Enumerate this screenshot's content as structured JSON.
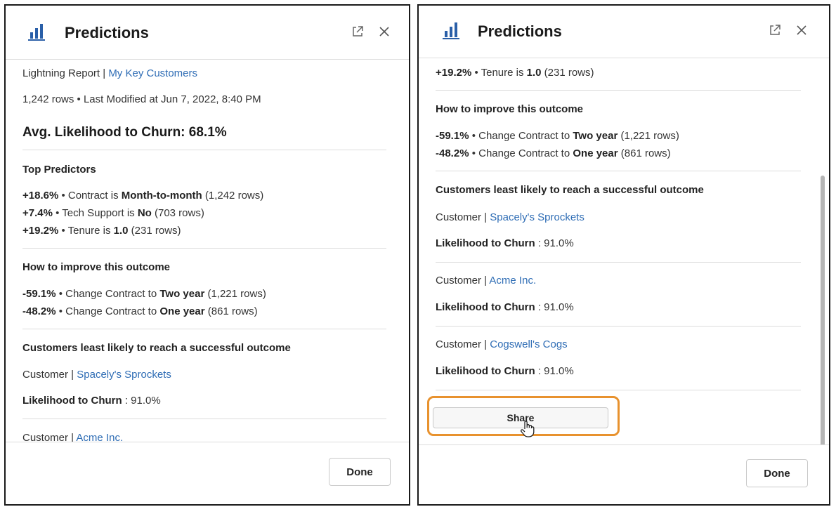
{
  "left_panel": {
    "title": "Predictions",
    "report_type": "Lightning Report",
    "report_name": "My Key Customers",
    "meta": "1,242 rows • Last Modified at Jun 7, 2022, 8:40 PM",
    "avg_label": "Avg. Likelihood to Churn: 68.1%",
    "top_predictors_title": "Top Predictors",
    "predictors": [
      {
        "pct": "+18.6%",
        "pre": " • Contract is ",
        "val": "Month-to-month",
        "rows": " (1,242 rows)"
      },
      {
        "pct": "+7.4%",
        "pre": " • Tech Support is ",
        "val": "No",
        "rows": " (703 rows)"
      },
      {
        "pct": "+19.2%",
        "pre": " • Tenure is ",
        "val": "1.0",
        "rows": " (231 rows)"
      }
    ],
    "improve_title": "How to improve this outcome",
    "improvements": [
      {
        "pct": "-59.1%",
        "pre": " • Change Contract to ",
        "val": "Two year",
        "rows": " (1,221 rows)"
      },
      {
        "pct": "-48.2%",
        "pre": " • Change Contract to ",
        "val": "One year",
        "rows": " (861 rows)"
      }
    ],
    "customers_title": "Customers least likely to reach a successful outcome",
    "customers": [
      {
        "prefix": "Customer | ",
        "name": "Spacely's Sprockets",
        "like_label": "Likelihood to Churn",
        "like_value": " : 91.0%"
      },
      {
        "prefix": "Customer | ",
        "name": "Acme Inc."
      }
    ],
    "done_label": "Done"
  },
  "right_panel": {
    "title": "Predictions",
    "tenure": {
      "pct": "+19.2%",
      "pre": " • Tenure is ",
      "val": "1.0",
      "rows": " (231 rows)"
    },
    "improve_title": "How to improve this outcome",
    "improvements": [
      {
        "pct": "-59.1%",
        "pre": " • Change Contract to ",
        "val": "Two year",
        "rows": " (1,221 rows)"
      },
      {
        "pct": "-48.2%",
        "pre": " • Change Contract to ",
        "val": "One year",
        "rows": " (861 rows)"
      }
    ],
    "customers_title": "Customers least likely to reach a successful outcome",
    "customers": [
      {
        "prefix": "Customer | ",
        "name": "Spacely's Sprockets",
        "like_label": "Likelihood to Churn",
        "like_value": " : 91.0%"
      },
      {
        "prefix": "Customer | ",
        "name": "Acme Inc.",
        "like_label": "Likelihood to Churn",
        "like_value": " : 91.0%"
      },
      {
        "prefix": "Customer | ",
        "name": "Cogswell's Cogs",
        "like_label": "Likelihood to Churn",
        "like_value": " : 91.0%"
      }
    ],
    "share_label": "Share",
    "done_label": "Done"
  },
  "icons": {
    "chart": "bar-chart-icon",
    "open": "open-new-window-icon",
    "close": "close-icon",
    "cursor": "hand-pointer-icon"
  },
  "colors": {
    "link": "#2f6db5",
    "chart_icon": "#2a5fa8",
    "highlight": "#e8922e"
  }
}
